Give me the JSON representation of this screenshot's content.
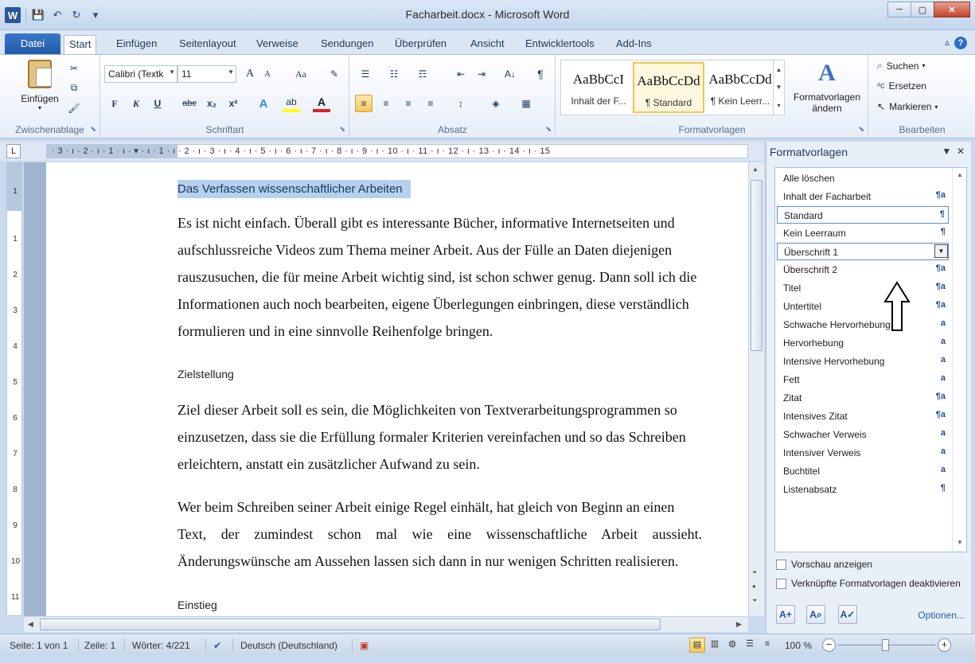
{
  "window": {
    "title": "Facharbeit.docx - Microsoft Word",
    "app_icon": "W",
    "controls": {
      "minimize": "─",
      "maximize": "▢",
      "close": "✕"
    }
  },
  "qat": {
    "save": "💾",
    "undo": "↶",
    "redo": "↻",
    "customize": "▾"
  },
  "tabs": [
    {
      "label": "Datei"
    },
    {
      "label": "Start"
    },
    {
      "label": "Einfügen"
    },
    {
      "label": "Seitenlayout"
    },
    {
      "label": "Verweise"
    },
    {
      "label": "Sendungen"
    },
    {
      "label": "Überprüfen"
    },
    {
      "label": "Ansicht"
    },
    {
      "label": "Entwicklertools"
    },
    {
      "label": "Add-Ins"
    }
  ],
  "ribbon": {
    "clipboard": {
      "group_label": "Zwischenablage",
      "paste_label": "Einfügen",
      "cut": "✂",
      "copy": "⧉",
      "format_painter": "🖌"
    },
    "font": {
      "group_label": "Schriftart",
      "font_name": "Calibri (Textk",
      "font_size": "11",
      "grow": "A",
      "shrink": "A",
      "change_case": "Aa",
      "clear": "✎",
      "bold": "F",
      "italic": "K",
      "underline": "U",
      "strike": "abc",
      "subscript": "x₂",
      "superscript": "x²",
      "effects": "A",
      "highlight": "ab",
      "font_color": "A"
    },
    "paragraph": {
      "group_label": "Absatz",
      "bullets": "☰",
      "numbering": "☷",
      "multilevel": "☶",
      "decrease_indent": "⇤",
      "increase_indent": "⇥",
      "sort": "A↓",
      "show_marks": "¶",
      "align_left": "≡",
      "center": "≡",
      "align_right": "≡",
      "justify": "≡",
      "line_spacing": "↕",
      "shading": "◈",
      "borders": "▦"
    },
    "styles": {
      "group_label": "Formatvorlagen",
      "tiles": [
        {
          "sample": "AaBbCcI",
          "name": "Inhalt der F..."
        },
        {
          "sample": "AaBbCcDd",
          "name": "¶ Standard"
        },
        {
          "sample": "AaBbCcDd",
          "name": "¶ Kein Leerr..."
        }
      ],
      "change_styles_line1": "Formatvorlagen",
      "change_styles_line2": "ändern"
    },
    "editing": {
      "group_label": "Bearbeiten",
      "find": "Suchen",
      "replace": "Ersetzen",
      "select": "Markieren"
    }
  },
  "ruler": {
    "tab_selector": "L",
    "numbers": "· 3 · ı · 2 · ı · 1 · ı · ▾ · ı · 1 · ı · 2 · ı · 3 · ı · 4 · ı · 5 · ı · 6 · ı · 7 · ı · 8 · ı · 9 · ı · 10 · ı · 11 · ı · 12 · ı · 13 · ı · 14 · ı · 15",
    "vertical_numbers": [
      "1",
      "1",
      "2",
      "3",
      "4",
      "5",
      "6",
      "7",
      "8",
      "9",
      "10",
      "11"
    ]
  },
  "document": {
    "heading": "Das Verfassen wissenschaftlicher Arbeiten",
    "paragraph1": [
      "Es ist nicht einfach. Überall gibt es interessante Bücher, informative Internetseiten und",
      "aufschlussreiche Videos zum Thema meiner Arbeit. Aus der Fülle an Daten diejenigen",
      "rauszusuchen, die für meine Arbeit wichtig sind, ist schon schwer genug. Dann soll ich die",
      "Informationen auch noch bearbeiten, eigene Überlegungen einbringen, diese verständlich",
      "formulieren und in eine sinnvolle Reihenfolge bringen."
    ],
    "subheading1": "Zielstellung",
    "paragraph2": [
      "Ziel dieser Arbeit soll es sein, die Möglichkeiten von Textverarbeitungsprogrammen so",
      "einzusetzen, dass sie die Erfüllung formaler Kriterien vereinfachen und so das Schreiben",
      "erleichtern, anstatt ein zusätzlicher Aufwand zu sein."
    ],
    "paragraph3": [
      "Wer beim Schreiben seiner Arbeit einige Regel einhält, hat gleich von Beginn an einen",
      "Text, der zumindest schon mal wie eine wissenschaftliche Arbeit aussieht.",
      "Änderungswünsche am Aussehen lassen sich dann in nur wenigen Schritten realisieren."
    ],
    "subheading2": "Einstieg"
  },
  "styles_pane": {
    "title": "Formatvorlagen",
    "items": [
      {
        "label": "Alle löschen",
        "mark": ""
      },
      {
        "label": "Inhalt der Facharbeit",
        "mark": "¶a"
      },
      {
        "label": "Standard",
        "mark": "¶"
      },
      {
        "label": "Kein Leerraum",
        "mark": "¶"
      },
      {
        "label": "Überschrift 1",
        "mark": "▼"
      },
      {
        "label": "Überschrift 2",
        "mark": "¶a"
      },
      {
        "label": "Titel",
        "mark": "¶a"
      },
      {
        "label": "Untertitel",
        "mark": "¶a"
      },
      {
        "label": "Schwache Hervorhebung",
        "mark": "a"
      },
      {
        "label": "Hervorhebung",
        "mark": "a"
      },
      {
        "label": "Intensive Hervorhebung",
        "mark": "a"
      },
      {
        "label": "Fett",
        "mark": "a"
      },
      {
        "label": "Zitat",
        "mark": "¶a"
      },
      {
        "label": "Intensives Zitat",
        "mark": "¶a"
      },
      {
        "label": "Schwacher Verweis",
        "mark": "a"
      },
      {
        "label": "Intensiver Verweis",
        "mark": "a"
      },
      {
        "label": "Buchtitel",
        "mark": "a"
      },
      {
        "label": "Listenabsatz",
        "mark": "¶"
      }
    ],
    "preview_checkbox": "Vorschau anzeigen",
    "linked_checkbox": "Verknüpfte Formatvorlagen deaktivieren",
    "options_link": "Optionen..."
  },
  "statusbar": {
    "page": "Seite: 1 von 1",
    "line": "Zeile: 1",
    "words": "Wörter: 4/221",
    "language": "Deutsch (Deutschland)",
    "zoom": "100 %"
  },
  "colors": {
    "accent": "#2b579a",
    "heading_highlight": "#b6d0ee",
    "selected_style_border": "#5a8fd4"
  }
}
